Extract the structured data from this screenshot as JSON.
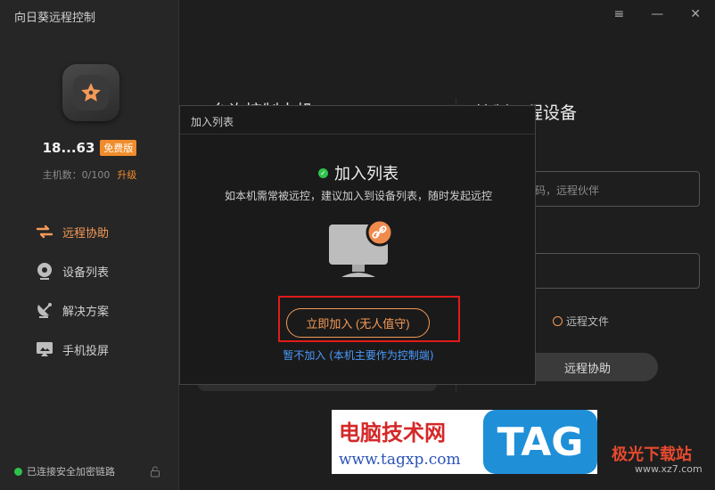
{
  "app": {
    "title": "向日葵远程控制"
  },
  "window_controls": {
    "menu": "≡",
    "minimize": "—",
    "close": "✕"
  },
  "user": {
    "id": "18...63",
    "plan_badge": "免费版",
    "host_count_label": "主机数：0/100",
    "upgrade": "升级"
  },
  "sidebar": {
    "items": [
      {
        "label": "远程协助",
        "icon": "remote-assist-icon",
        "active": true
      },
      {
        "label": "设备列表",
        "icon": "device-list-icon",
        "active": false
      },
      {
        "label": "解决方案",
        "icon": "solution-icon",
        "active": false
      },
      {
        "label": "手机投屏",
        "icon": "screen-mirror-icon",
        "active": false
      }
    ],
    "status": "已连接安全加密链路"
  },
  "main": {
    "left_title": "允许控制本机",
    "right_title": "控制远程设备",
    "field1_placeholder": "码，远程伙伴",
    "remote_file": "远程文件",
    "assist_button": "远程协助"
  },
  "modal": {
    "header": "加入列表",
    "title": "加入列表",
    "description": "如本机需常被远控，建议加入到设备列表，随时发起远控",
    "join_button": "立即加入 (无人值守)",
    "skip_link": "暂不加入 (本机主要作为控制端)"
  },
  "watermark": {
    "site_name": "电脑技术网",
    "site_url": "www.tagxp.com",
    "tag": "TAG",
    "site2": "极光下载站",
    "site2_url": "www.xz7.com"
  },
  "colors": {
    "accent": "#f59a57",
    "badge": "#f08c2b",
    "link": "#4a9bff",
    "online": "#2fc24b",
    "highlight": "#e01b1b"
  }
}
